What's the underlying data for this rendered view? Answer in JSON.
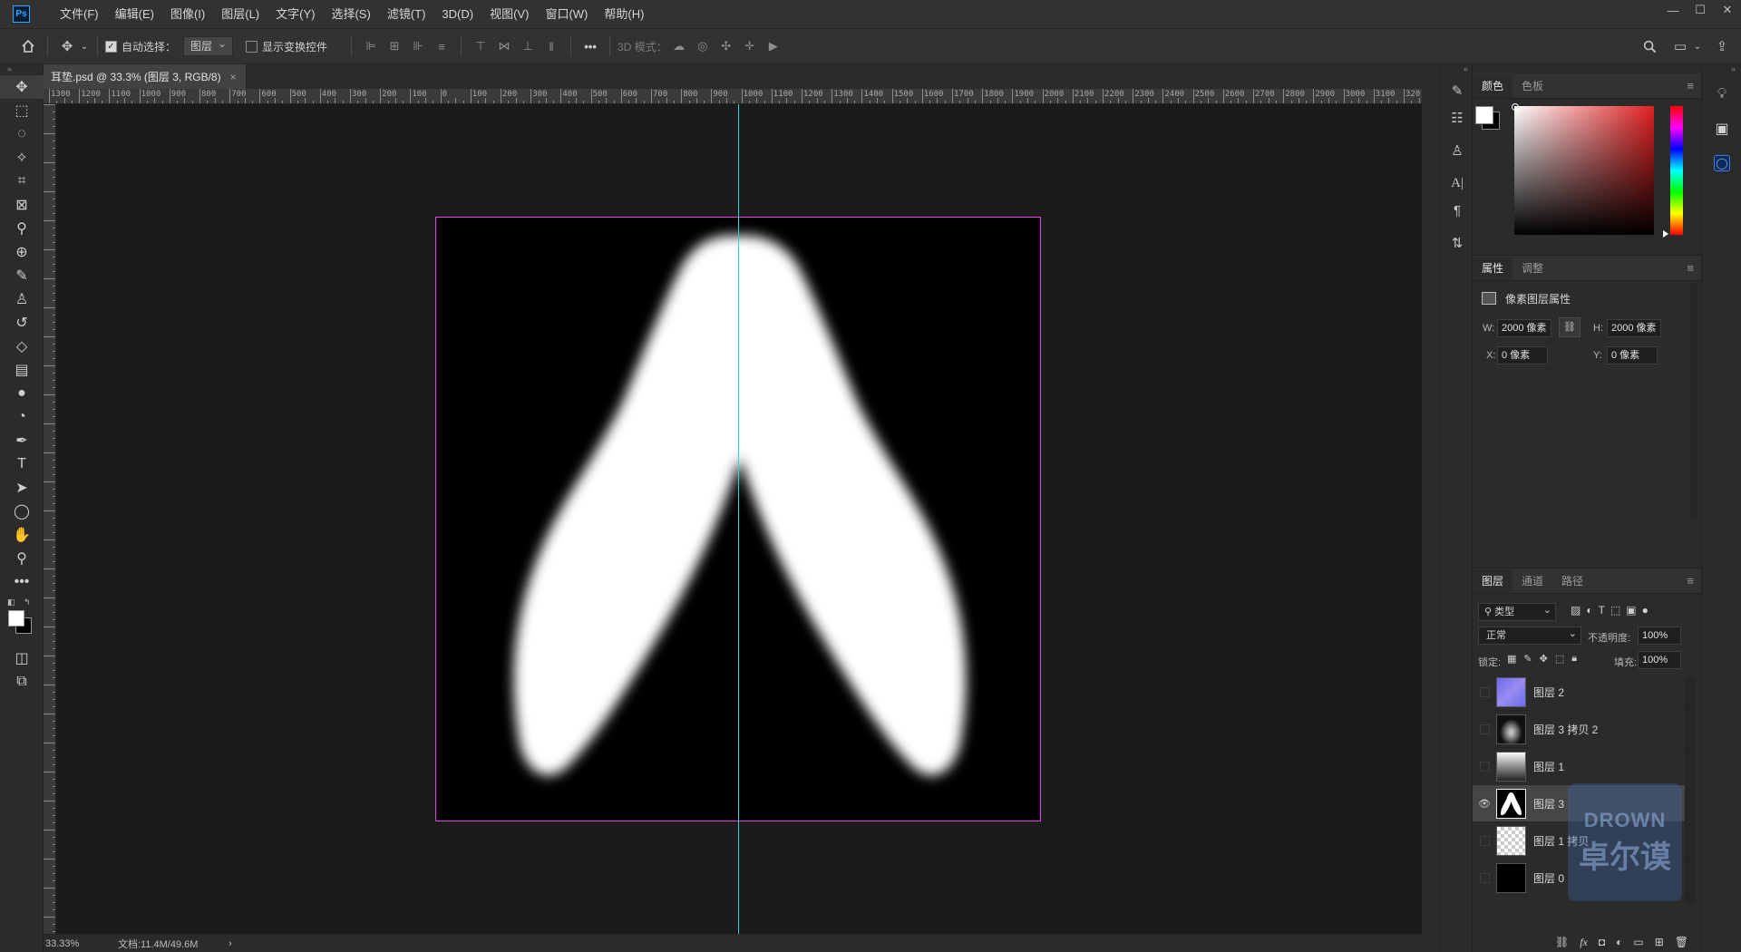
{
  "menubar": {
    "logo": "Ps",
    "items": [
      "文件(F)",
      "编辑(E)",
      "图像(I)",
      "图层(L)",
      "文字(Y)",
      "选择(S)",
      "滤镜(T)",
      "3D(D)",
      "视图(V)",
      "窗口(W)",
      "帮助(H)"
    ],
    "window_controls": [
      "minimize",
      "maximize",
      "close"
    ]
  },
  "options": {
    "auto_select_label": "自动选择：",
    "auto_select_checked": true,
    "auto_select_target": "图层",
    "show_transform_label": "显示变换控件",
    "show_transform_checked": false,
    "three_d_label": "3D 模式：",
    "more": "•••"
  },
  "document": {
    "tab_title": "耳垫.psd @ 33.3% (图层 3, RGB/8)",
    "close_glyph": "×",
    "zoom": "33.33%",
    "doc_info": "文档:11.4M/49.6M",
    "status_arrow": "›"
  },
  "ruler": {
    "h_labels": [
      "1300",
      "1200",
      "1100",
      "1000",
      "900",
      "800",
      "700",
      "600",
      "500",
      "400",
      "300",
      "200",
      "100",
      "0",
      "100",
      "200",
      "300",
      "400",
      "500",
      "600",
      "700",
      "800",
      "900",
      "1000",
      "1100",
      "1200",
      "1300",
      "1400",
      "1500",
      "1600",
      "1700",
      "1800",
      "1900",
      "2000",
      "2100",
      "2200",
      "2300",
      "2400",
      "2500",
      "2600",
      "2700",
      "2800",
      "2900",
      "3000",
      "3100",
      "320"
    ]
  },
  "color_panel": {
    "tabs": [
      "颜色",
      "色板"
    ],
    "active_tab": "颜色",
    "foreground": "#ffffff",
    "background": "#000000",
    "hue_color": "#e02020"
  },
  "properties_panel": {
    "tabs": [
      "属性",
      "调整"
    ],
    "active_tab": "属性",
    "title": "像素图层属性",
    "w_label": "W:",
    "w_value": "2000 像素",
    "h_label": "H:",
    "h_value": "2000 像素",
    "x_label": "X:",
    "x_value": "0 像素",
    "y_label": "Y:",
    "y_value": "0 像素"
  },
  "layers_panel": {
    "tabs": [
      "图层",
      "通道",
      "路径"
    ],
    "active_tab": "图层",
    "filter_label": "类型",
    "blend_mode": "正常",
    "opacity_label": "不透明度:",
    "opacity_value": "100%",
    "lock_label": "锁定:",
    "fill_label": "填充:",
    "fill_value": "100%",
    "layers": [
      {
        "name": "图层 2",
        "visible": false,
        "thumb": "purple"
      },
      {
        "name": "图层 3 拷贝 2",
        "visible": false,
        "thumb": "shape-gray"
      },
      {
        "name": "图层 1",
        "visible": false,
        "thumb": "gradient"
      },
      {
        "name": "图层 3",
        "visible": true,
        "selected": true,
        "thumb": "shape-white"
      },
      {
        "name": "图层 1 拷贝",
        "visible": false,
        "thumb": "transparent"
      },
      {
        "name": "图层 0",
        "visible": false,
        "thumb": "black"
      }
    ]
  },
  "watermark": {
    "line1": "DROWN",
    "line2": "卓尔谟"
  }
}
